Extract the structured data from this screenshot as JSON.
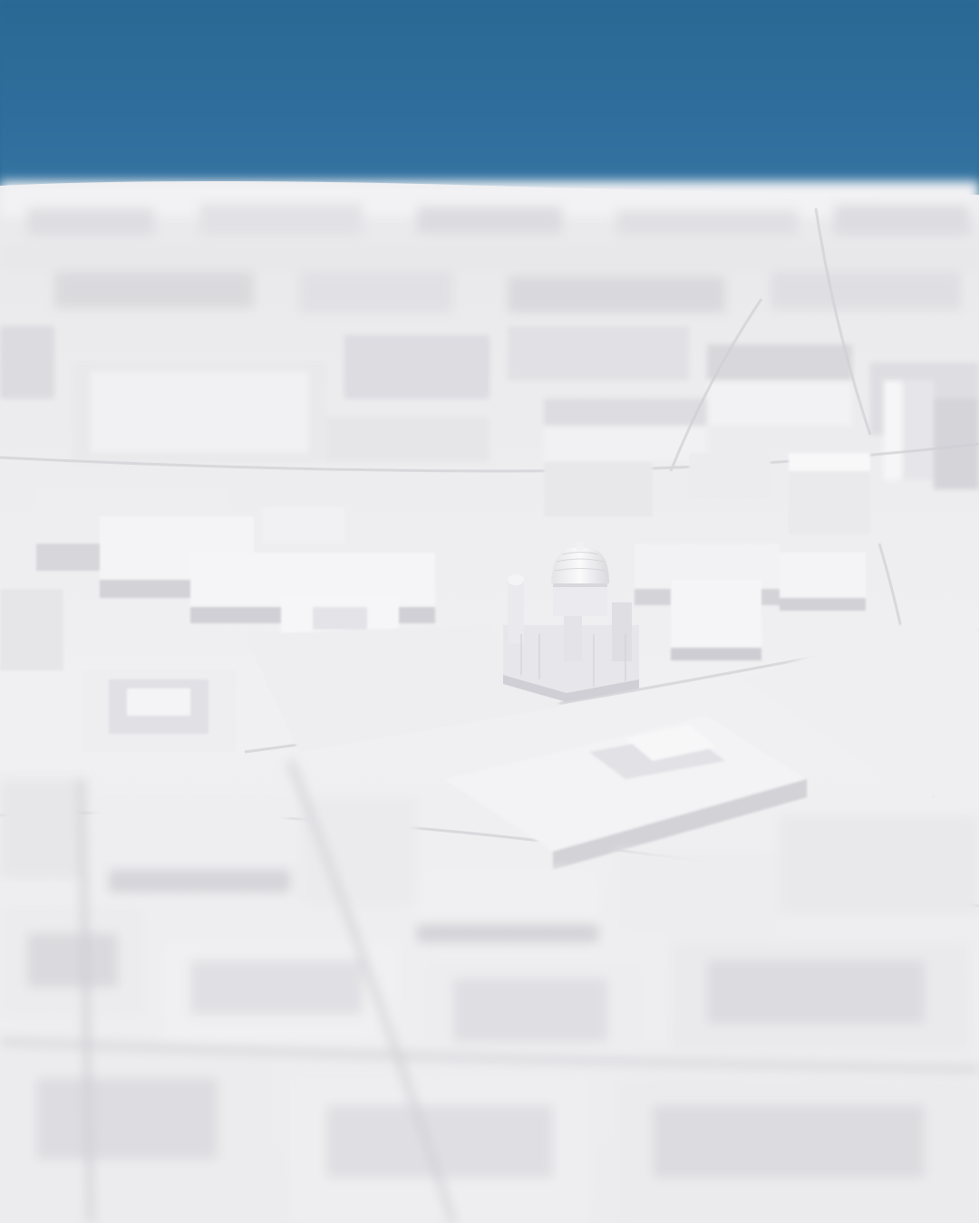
{
  "photo": {
    "subject": "",
    "colors": {
      "background": "#2c6a98",
      "model_base": "#eeeeef",
      "model_shadow": "#d2d2d6",
      "model_highlight": "#fbfbfc"
    }
  }
}
